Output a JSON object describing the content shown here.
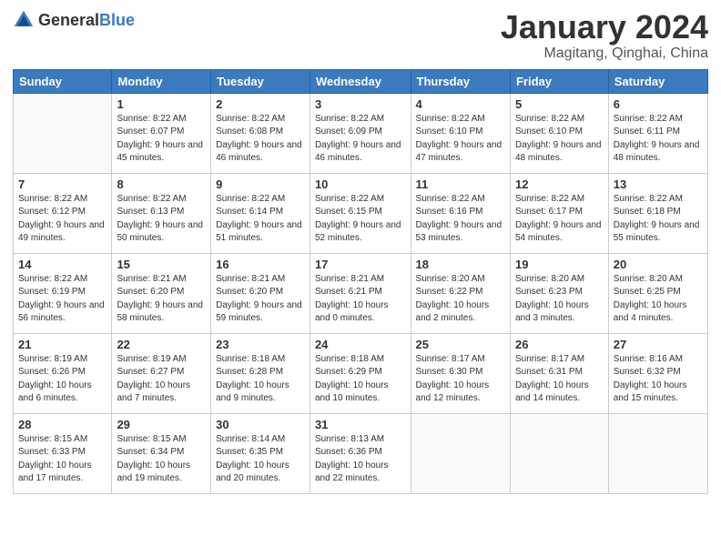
{
  "header": {
    "logo_general": "General",
    "logo_blue": "Blue",
    "month": "January 2024",
    "location": "Magitang, Qinghai, China"
  },
  "weekdays": [
    "Sunday",
    "Monday",
    "Tuesday",
    "Wednesday",
    "Thursday",
    "Friday",
    "Saturday"
  ],
  "weeks": [
    [
      {
        "day": "",
        "sunrise": "",
        "sunset": "",
        "daylight": ""
      },
      {
        "day": "1",
        "sunrise": "Sunrise: 8:22 AM",
        "sunset": "Sunset: 6:07 PM",
        "daylight": "Daylight: 9 hours and 45 minutes."
      },
      {
        "day": "2",
        "sunrise": "Sunrise: 8:22 AM",
        "sunset": "Sunset: 6:08 PM",
        "daylight": "Daylight: 9 hours and 46 minutes."
      },
      {
        "day": "3",
        "sunrise": "Sunrise: 8:22 AM",
        "sunset": "Sunset: 6:09 PM",
        "daylight": "Daylight: 9 hours and 46 minutes."
      },
      {
        "day": "4",
        "sunrise": "Sunrise: 8:22 AM",
        "sunset": "Sunset: 6:10 PM",
        "daylight": "Daylight: 9 hours and 47 minutes."
      },
      {
        "day": "5",
        "sunrise": "Sunrise: 8:22 AM",
        "sunset": "Sunset: 6:10 PM",
        "daylight": "Daylight: 9 hours and 48 minutes."
      },
      {
        "day": "6",
        "sunrise": "Sunrise: 8:22 AM",
        "sunset": "Sunset: 6:11 PM",
        "daylight": "Daylight: 9 hours and 48 minutes."
      }
    ],
    [
      {
        "day": "7",
        "sunrise": "Sunrise: 8:22 AM",
        "sunset": "Sunset: 6:12 PM",
        "daylight": "Daylight: 9 hours and 49 minutes."
      },
      {
        "day": "8",
        "sunrise": "Sunrise: 8:22 AM",
        "sunset": "Sunset: 6:13 PM",
        "daylight": "Daylight: 9 hours and 50 minutes."
      },
      {
        "day": "9",
        "sunrise": "Sunrise: 8:22 AM",
        "sunset": "Sunset: 6:14 PM",
        "daylight": "Daylight: 9 hours and 51 minutes."
      },
      {
        "day": "10",
        "sunrise": "Sunrise: 8:22 AM",
        "sunset": "Sunset: 6:15 PM",
        "daylight": "Daylight: 9 hours and 52 minutes."
      },
      {
        "day": "11",
        "sunrise": "Sunrise: 8:22 AM",
        "sunset": "Sunset: 6:16 PM",
        "daylight": "Daylight: 9 hours and 53 minutes."
      },
      {
        "day": "12",
        "sunrise": "Sunrise: 8:22 AM",
        "sunset": "Sunset: 6:17 PM",
        "daylight": "Daylight: 9 hours and 54 minutes."
      },
      {
        "day": "13",
        "sunrise": "Sunrise: 8:22 AM",
        "sunset": "Sunset: 6:18 PM",
        "daylight": "Daylight: 9 hours and 55 minutes."
      }
    ],
    [
      {
        "day": "14",
        "sunrise": "Sunrise: 8:22 AM",
        "sunset": "Sunset: 6:19 PM",
        "daylight": "Daylight: 9 hours and 56 minutes."
      },
      {
        "day": "15",
        "sunrise": "Sunrise: 8:21 AM",
        "sunset": "Sunset: 6:20 PM",
        "daylight": "Daylight: 9 hours and 58 minutes."
      },
      {
        "day": "16",
        "sunrise": "Sunrise: 8:21 AM",
        "sunset": "Sunset: 6:20 PM",
        "daylight": "Daylight: 9 hours and 59 minutes."
      },
      {
        "day": "17",
        "sunrise": "Sunrise: 8:21 AM",
        "sunset": "Sunset: 6:21 PM",
        "daylight": "Daylight: 10 hours and 0 minutes."
      },
      {
        "day": "18",
        "sunrise": "Sunrise: 8:20 AM",
        "sunset": "Sunset: 6:22 PM",
        "daylight": "Daylight: 10 hours and 2 minutes."
      },
      {
        "day": "19",
        "sunrise": "Sunrise: 8:20 AM",
        "sunset": "Sunset: 6:23 PM",
        "daylight": "Daylight: 10 hours and 3 minutes."
      },
      {
        "day": "20",
        "sunrise": "Sunrise: 8:20 AM",
        "sunset": "Sunset: 6:25 PM",
        "daylight": "Daylight: 10 hours and 4 minutes."
      }
    ],
    [
      {
        "day": "21",
        "sunrise": "Sunrise: 8:19 AM",
        "sunset": "Sunset: 6:26 PM",
        "daylight": "Daylight: 10 hours and 6 minutes."
      },
      {
        "day": "22",
        "sunrise": "Sunrise: 8:19 AM",
        "sunset": "Sunset: 6:27 PM",
        "daylight": "Daylight: 10 hours and 7 minutes."
      },
      {
        "day": "23",
        "sunrise": "Sunrise: 8:18 AM",
        "sunset": "Sunset: 6:28 PM",
        "daylight": "Daylight: 10 hours and 9 minutes."
      },
      {
        "day": "24",
        "sunrise": "Sunrise: 8:18 AM",
        "sunset": "Sunset: 6:29 PM",
        "daylight": "Daylight: 10 hours and 10 minutes."
      },
      {
        "day": "25",
        "sunrise": "Sunrise: 8:17 AM",
        "sunset": "Sunset: 6:30 PM",
        "daylight": "Daylight: 10 hours and 12 minutes."
      },
      {
        "day": "26",
        "sunrise": "Sunrise: 8:17 AM",
        "sunset": "Sunset: 6:31 PM",
        "daylight": "Daylight: 10 hours and 14 minutes."
      },
      {
        "day": "27",
        "sunrise": "Sunrise: 8:16 AM",
        "sunset": "Sunset: 6:32 PM",
        "daylight": "Daylight: 10 hours and 15 minutes."
      }
    ],
    [
      {
        "day": "28",
        "sunrise": "Sunrise: 8:15 AM",
        "sunset": "Sunset: 6:33 PM",
        "daylight": "Daylight: 10 hours and 17 minutes."
      },
      {
        "day": "29",
        "sunrise": "Sunrise: 8:15 AM",
        "sunset": "Sunset: 6:34 PM",
        "daylight": "Daylight: 10 hours and 19 minutes."
      },
      {
        "day": "30",
        "sunrise": "Sunrise: 8:14 AM",
        "sunset": "Sunset: 6:35 PM",
        "daylight": "Daylight: 10 hours and 20 minutes."
      },
      {
        "day": "31",
        "sunrise": "Sunrise: 8:13 AM",
        "sunset": "Sunset: 6:36 PM",
        "daylight": "Daylight: 10 hours and 22 minutes."
      },
      {
        "day": "",
        "sunrise": "",
        "sunset": "",
        "daylight": ""
      },
      {
        "day": "",
        "sunrise": "",
        "sunset": "",
        "daylight": ""
      },
      {
        "day": "",
        "sunrise": "",
        "sunset": "",
        "daylight": ""
      }
    ]
  ]
}
